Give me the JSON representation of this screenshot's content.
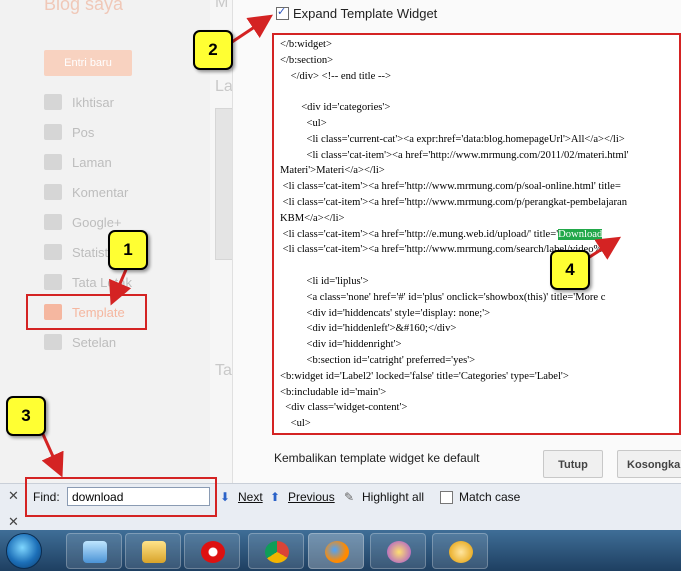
{
  "sidebar": {
    "blog_title": "Blog saya",
    "new_post": "Entri baru",
    "items": [
      {
        "label": "Ikhtisar"
      },
      {
        "label": "Pos"
      },
      {
        "label": "Laman"
      },
      {
        "label": "Komentar"
      },
      {
        "label": "Google+"
      },
      {
        "label": "Statistik"
      },
      {
        "label": "Tata Letak"
      },
      {
        "label": "Template"
      },
      {
        "label": "Setelan"
      }
    ]
  },
  "background": {
    "heading": "M",
    "label_la": "La",
    "label_ta": "Ta"
  },
  "dialog": {
    "expand_label": "Expand Template Widget",
    "expand_checked": true,
    "code_lines": [
      "</b:widget>",
      "</b:section>",
      "    </div> <!-- end title -->",
      "",
      "        <div id='categories'>",
      "          <ul>",
      "          <li class='current-cat'><a expr:href='data:blog.homepageUrl'>All</a></li>",
      "          <li class='cat-item'><a href='http://www.mrmung.com/2011/02/materi.html'",
      "Materi'>Materi</a></li>",
      " <li class='cat-item'><a href='http://www.mrmung.com/p/soal-online.html' title=",
      " <li class='cat-item'><a href='http://www.mrmung.com/p/perangkat-pembelajaran",
      "KBM</a></li>",
      " <li class='cat-item'><a href='http://e.mung.web.id/upload/' title='",
      " <li class='cat-item'><a href='http://www.mrmung.com/search/label/video%20",
      "",
      "          <li id='liplus'>",
      "          <a class='none' href='#' id='plus' onclick='showbox(this)' title='More c",
      "          <div id='hiddencats' style='display: none;'>",
      "          <div id='hiddenleft'>&#160;</div>",
      "          <div id='hiddenright'>",
      "          <b:section id='catright' preferred='yes'>",
      "<b:widget id='Label2' locked='false' title='Categories' type='Label'>",
      "<b:includable id='main'>",
      "  <div class='widget-content'>",
      "    <ul>"
    ],
    "highlight_line_index": 12,
    "highlight_text": "Download",
    "reset_link": "Kembalikan template widget ke default",
    "close_button": "Tutup",
    "clear_button": "Kosongkan"
  },
  "findbar": {
    "label": "Find:",
    "value": "download",
    "next": "Next",
    "previous": "Previous",
    "highlight_all": "Highlight all",
    "match_case": "Match case",
    "match_case_checked": false
  },
  "annotations": [
    "1",
    "2",
    "3",
    "4"
  ],
  "colors": {
    "annotation_fill": "#ffff33",
    "annotation_border": "#d42323",
    "highlight": "#22a84a",
    "template_accent": "#f5b7a0"
  },
  "taskbar": {
    "apps": [
      "start-orb",
      "notepad-icon",
      "explorer-icon",
      "opera-icon",
      "chrome-icon",
      "firefox-icon",
      "messenger-icon",
      "media-player-icon"
    ]
  }
}
